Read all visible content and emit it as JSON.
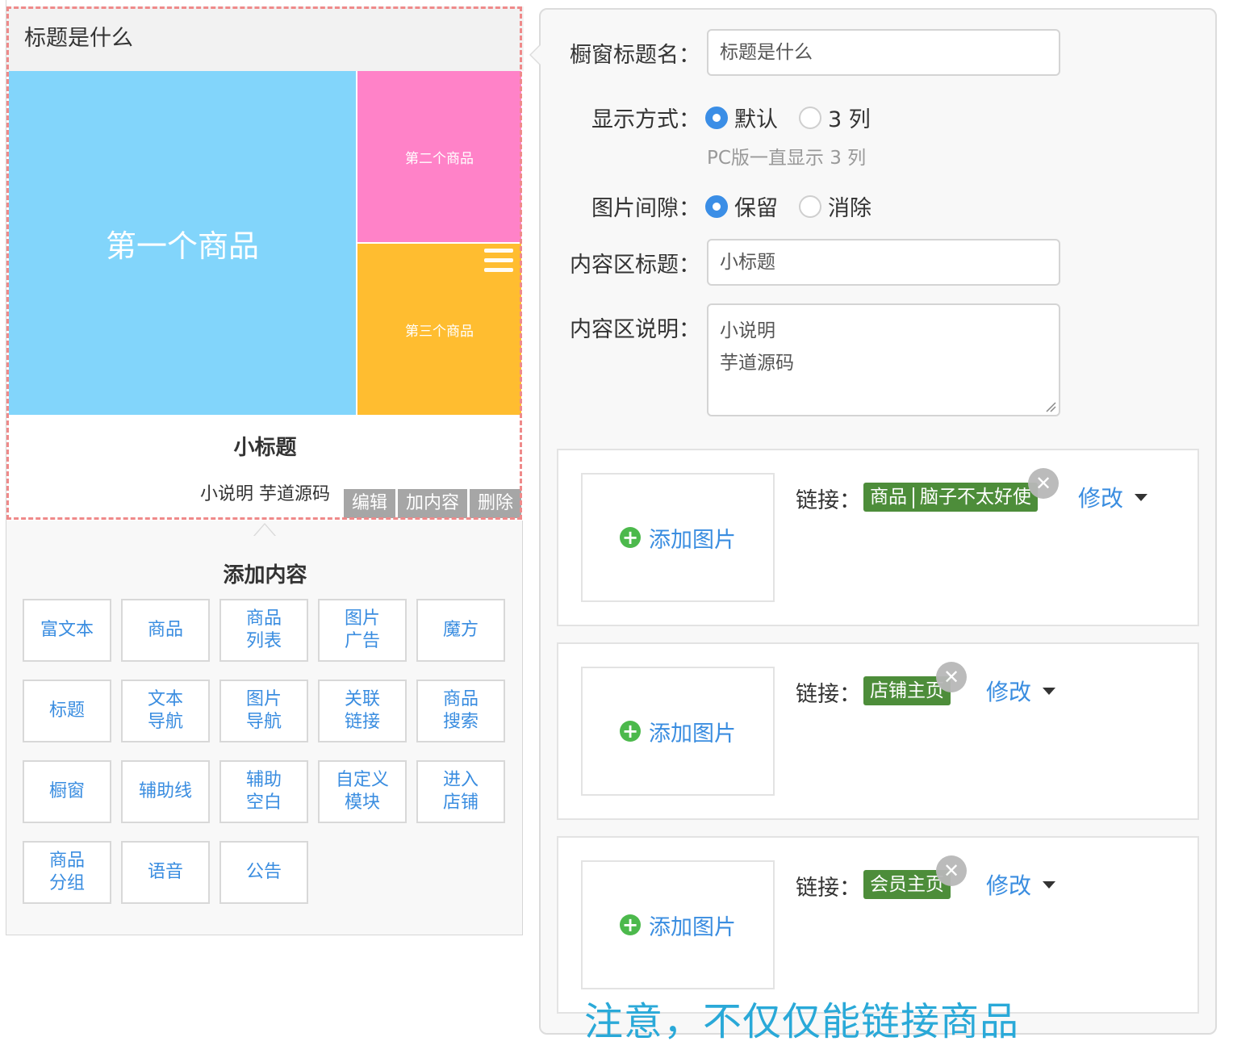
{
  "preview": {
    "window_title": "标题是什么",
    "items": [
      "第一个商品",
      "第二个商品",
      "第三个商品"
    ],
    "subtitle": "小标题",
    "description": "小说明 芋道源码",
    "actions": [
      "编辑",
      "加内容",
      "删除"
    ]
  },
  "add_content": {
    "title": "添加内容",
    "buttons": [
      "富文本",
      "商品",
      "商品\n列表",
      "图片\n广告",
      "魔方",
      "标题",
      "文本\n导航",
      "图片\n导航",
      "关联\n链接",
      "商品\n搜索",
      "橱窗",
      "辅助线",
      "辅助\n空白",
      "自定义\n模块",
      "进入\n店铺",
      "商品\n分组",
      "语音",
      "公告"
    ]
  },
  "form": {
    "title_label": "橱窗标题名：",
    "title_value": "标题是什么",
    "display_label": "显示方式：",
    "display_options": [
      "默认",
      "3 列"
    ],
    "display_selected": "默认",
    "display_hint": "PC版一直显示 3 列",
    "gap_label": "图片间隙：",
    "gap_options": [
      "保留",
      "消除"
    ],
    "gap_selected": "保留",
    "content_title_label": "内容区标题：",
    "content_title_value": "小标题",
    "content_desc_label": "内容区说明：",
    "content_desc_lines": [
      "小说明",
      "芋道源码"
    ]
  },
  "cards": [
    {
      "add_image": "添加图片",
      "link_label": "链接：",
      "tag_type": "商品",
      "tag_name": "脑子不太好使",
      "modify": "修改"
    },
    {
      "add_image": "添加图片",
      "link_label": "链接：",
      "tag_type": "",
      "tag_name": "店铺主页",
      "modify": "修改"
    },
    {
      "add_image": "添加图片",
      "link_label": "链接：",
      "tag_type": "",
      "tag_name": "会员主页",
      "modify": "修改"
    }
  ],
  "note": "注意，不仅仅能链接商品",
  "colors": {
    "tile_1": "#82d5fb",
    "tile_2": "#ff82c8",
    "tile_3": "#ffbd30",
    "accent_blue": "#3a8de0",
    "tag_green": "#4d8d3a",
    "note_blue": "#2aa9d8",
    "dashed_border": "#ef8a8a"
  },
  "icons": [
    "drag-handle-icon",
    "plus-circle-icon",
    "close-icon",
    "caret-down-icon",
    "resize-grip-icon"
  ]
}
